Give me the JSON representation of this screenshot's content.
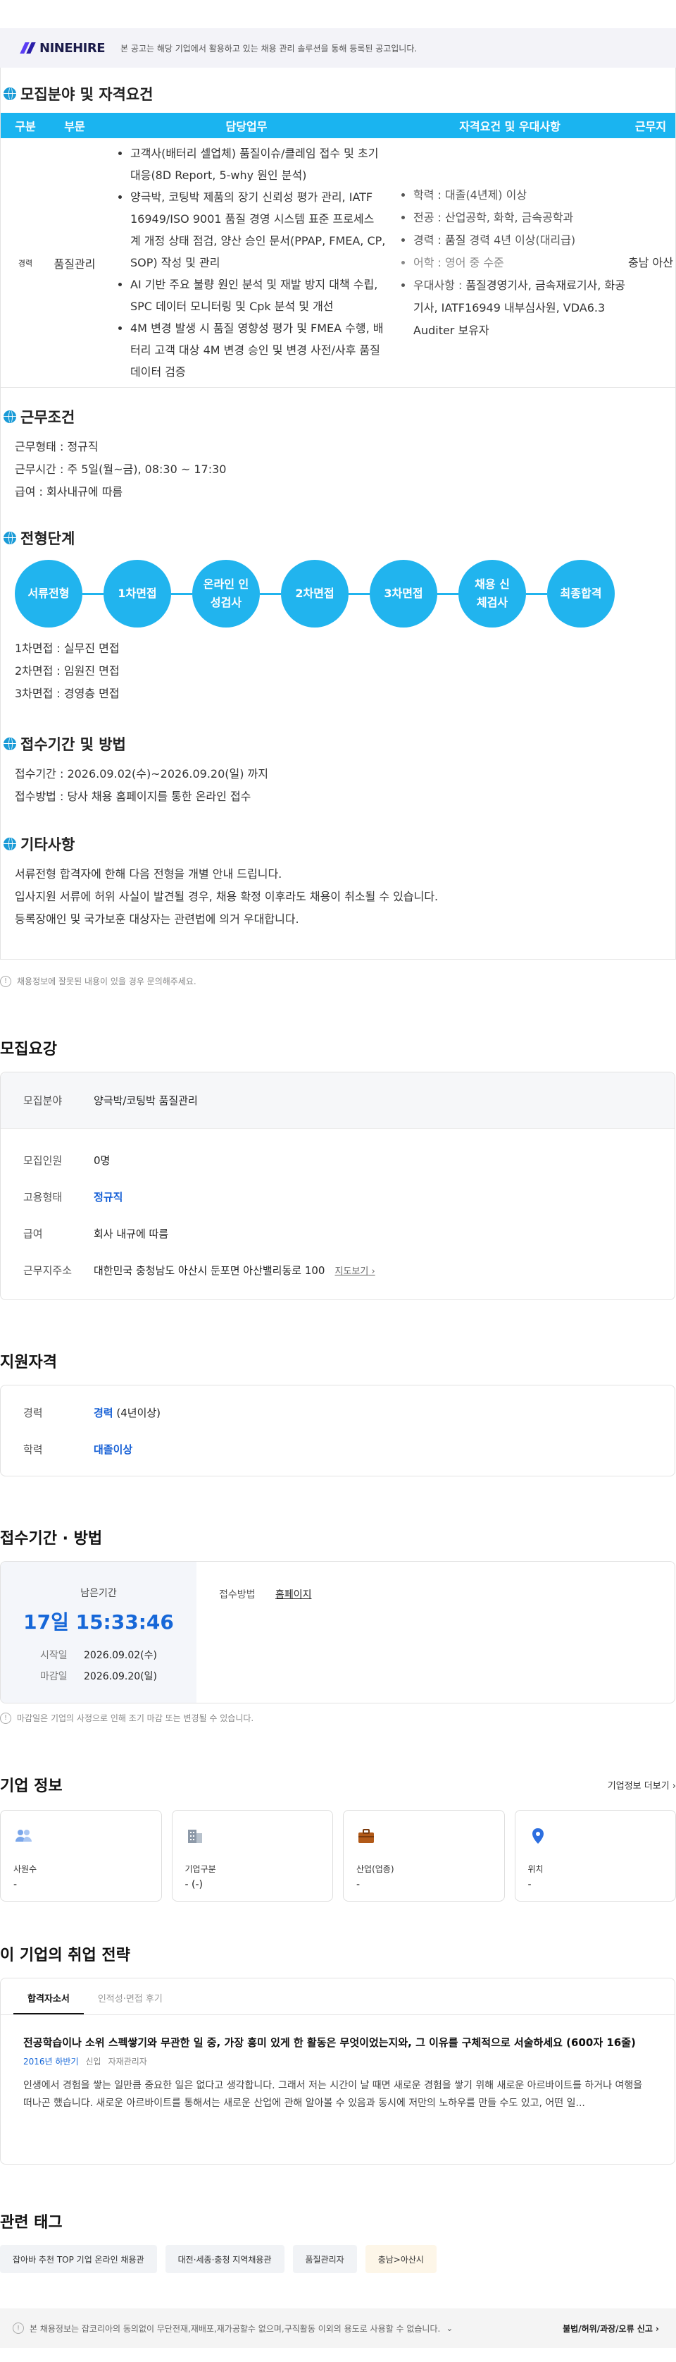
{
  "brand": {
    "name": "NINEHIRE",
    "note": "본 공고는 해당 기업에서 활용하고 있는 채용 관리 솔루션을 통해 등록된 공고입니다."
  },
  "recruit_table": {
    "title": "모집분야 및 자격요건",
    "headers": [
      "구분",
      "부문",
      "담당업무",
      "자격요건 및 우대사항",
      "근무지"
    ],
    "row": {
      "type": "경력",
      "division": "품질관리",
      "duties": [
        "고객사(배터리 셀업체) 품질이슈/클레임 접수 및 초기 대응(8D Report, 5-why 원인 분석)",
        "양극박, 코팅박 제품의 장기 신뢰성 평가 관리, IATF 16949/ISO 9001 품질 경영 시스템 표준 프로세스 계 개정 상태 점검, 양산 승인 문서(PPAP, FMEA, CP, SOP) 작성 및 관리",
        "AI 기반 주요 불량 원인 분석 및 재발 방지 대책 수립, SPC 데이터 모니터링 및 Cpk 분석 및 개선",
        "4M 변경 발생 시 품질 영향성 평가 및 FMEA 수행, 배터리 고객 대상 4M 변경 승인 및 변경 사전/사후 품질 데이터 검증"
      ],
      "quals": [
        {
          "text": "학력 : 대졸(4년제) 이상"
        },
        {
          "text": "전공 : 산업공학, 화학, 금속공학과"
        },
        {
          "label": "경력 : ",
          "strong": "품질",
          "rest": " 경력 4년 이상(대리급)"
        },
        {
          "text": "어학 : 영어 중 수준"
        },
        {
          "label": "우대사항 : ",
          "strong": "품질경영기사, 금속재료기사, 화공기사, IATF16949 내부심사원, VDA6.3 Auditer 보유자",
          "rest": ""
        }
      ],
      "location": "충남 아산"
    }
  },
  "conditions": {
    "title": "근무조건",
    "lines": [
      "근무형태 : 정규직",
      "근무시간 : 주 5일(월~금), 08:30 ~ 17:30",
      "급여 : 회사내규에 따름"
    ]
  },
  "process": {
    "title": "전형단계",
    "steps": [
      "서류전형",
      "1차면접",
      "온라인 인성검사",
      "2차면접",
      "3차면접",
      "채용 신체검사",
      "최종합격"
    ],
    "lines": [
      "1차면접 : 실무진 면접",
      "2차면접 : 임원진 면접",
      "3차면접 : 경영층 면접"
    ]
  },
  "apply": {
    "title": "접수기간 및 방법",
    "lines": [
      "접수기간 : 2026.09.02(수)~2026.09.20(일) 까지",
      "접수방법 : 당사 채용 홈페이지를 통한 온라인 접수"
    ]
  },
  "etc": {
    "title": "기타사항",
    "lines": [
      "서류전형 합격자에 한해 다음 전형을 개별 안내 드립니다.",
      "입사지원 서류에 허위 사실이 발견될 경우, 채용 확정 이후라도 채용이 취소될 수 있습니다.",
      "등록장애인 및 국가보훈 대상자는 관련법에 의거 우대합니다."
    ]
  },
  "disclaimer": "채용정보에 잘못된 내용이 있을 경우 문의해주세요.",
  "summary": {
    "title": "모집요강",
    "field_label": "모집분야",
    "field_value": "양극박/코팅박 품질관리",
    "rows": [
      {
        "label": "모집인원",
        "value": "0명",
        "blue": false
      },
      {
        "label": "고용형태",
        "value": "정규직",
        "blue": true
      },
      {
        "label": "급여",
        "value": "회사 내규에 따름",
        "blue": false
      },
      {
        "label": "근무지주소",
        "value": "대한민국 충청남도 아산시 둔포면 아산밸리동로 100",
        "blue": false
      }
    ],
    "map_link": "지도보기"
  },
  "qualifications": {
    "title": "지원자격",
    "career_label": "경력",
    "career_value": "경력",
    "career_extra": " (4년이상)",
    "edu_label": "학력",
    "edu_value": "대졸이상"
  },
  "period": {
    "title": "접수기간 · 방법",
    "remain_label": "남은기간",
    "remain_value": "17일 15:33:46",
    "start_label": "시작일",
    "start_value": "2026.09.02(수)",
    "end_label": "마감일",
    "end_value": "2026.09.20(일)",
    "method_label": "접수방법",
    "method_value": "홈페이지",
    "note": "마감일은 기업의 사정으로 인해 조기 마감 또는 변경될 수 있습니다."
  },
  "company": {
    "title": "기업 정보",
    "more": "기업정보 더보기",
    "cards": [
      {
        "icon": "people-icon",
        "label": "사원수",
        "value": "-"
      },
      {
        "icon": "building-icon",
        "label": "기업구분",
        "value": "- (-)"
      },
      {
        "icon": "briefcase-icon",
        "label": "산업(업종)",
        "value": "-"
      },
      {
        "icon": "location-pin-icon",
        "label": "위치",
        "value": "-"
      }
    ]
  },
  "strategy": {
    "title": "이 기업의 취업 전략",
    "tabs": [
      "합격자소서",
      "인적성·면접 후기"
    ],
    "question": "전공학습이나 소위 스펙쌓기와 무관한 일 중, 가장 흥미 있게 한 활동은 무엇이었는지와, 그 이유를 구체적으로 서술하세요 (600자 16줄)",
    "meta_term": "2016년 하반기",
    "meta_type": "신입",
    "meta_job": "자재관리자",
    "answer": "인생에서 경험을 쌓는 일만큼 중요한 일은 없다고 생각합니다. 그래서 저는 시간이 날 때면 새로운 경험을 쌓기 위해 새로운 아르바이트를 하거나 여행을 떠나곤 했습니다. 새로운 아르바이트를 통해서는 새로운 산업에 관해 알아볼 수 있음과 동시에 저만의 노하우를 만들 수도 있고, 어떤 일..."
  },
  "tags": {
    "title": "관련 태그",
    "items": [
      "잡아바 추천 TOP 기업 온라인 채용관",
      "대전·세종·충청 지역채용관",
      "품질관리자",
      "충남>아산시"
    ]
  },
  "footer": {
    "notice": "본 채용정보는 잡코리아의 동의없이 무단전재,재배포,재가공할수 없으며,구직활동 이외의 용도로 사용할 수 없습니다.",
    "report": "불법/허위/과장/오류 신고"
  },
  "colors": {
    "accent": "#1ab4f0",
    "blue": "#1667d8",
    "brand": "#5b3df5"
  }
}
